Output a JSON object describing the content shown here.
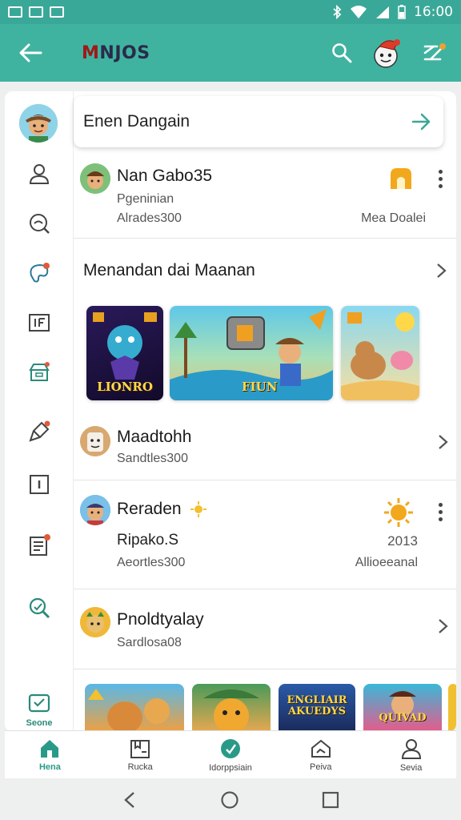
{
  "status_bar": {
    "time": "16:00"
  },
  "app_bar": {
    "logo_prefix": "M",
    "logo_rest": "NJOS"
  },
  "search_card": {
    "text": "Enen Dangain"
  },
  "rows": [
    {
      "title": "Nan Gabo35",
      "subtitle": "Pgeninian",
      "meta": "Alrades300",
      "right_meta": "Mea Doalei"
    },
    {
      "title": "Maadtohh",
      "subtitle": "Sandtles300"
    },
    {
      "title": "Reraden",
      "subtitle": "Ripako.S",
      "meta": "Aeortles300",
      "right_value": "2013",
      "right_meta": "Allioeeanal"
    },
    {
      "title": "Pnoldtyalay",
      "subtitle": "Sardlosa08"
    }
  ],
  "section": {
    "title": "Menandan  dai Maanan"
  },
  "thumbnails": [
    {
      "label": "LIONRO"
    },
    {
      "label": "FIUN"
    },
    {
      "label": ""
    }
  ],
  "bottom_thumbnails": [
    {
      "label": ""
    },
    {
      "label": ""
    },
    {
      "label": "ENGLIAIR AKUEDYS"
    },
    {
      "label": "QUIVAD"
    }
  ],
  "rail": {
    "store_label": "Seone"
  },
  "bottom_nav": [
    {
      "label": "Hena",
      "icon": "home-icon"
    },
    {
      "label": "Rucka",
      "icon": "book-icon"
    },
    {
      "label": "Idorppsiain",
      "icon": "compass-icon"
    },
    {
      "label": "Peiva",
      "icon": "house-icon"
    },
    {
      "label": "Sevia",
      "icon": "person-icon"
    }
  ],
  "colors": {
    "accent": "#3fb3a0",
    "status_bar": "#3aa898",
    "badge_red": "#e05a3a",
    "gold": "#f2a81d"
  }
}
